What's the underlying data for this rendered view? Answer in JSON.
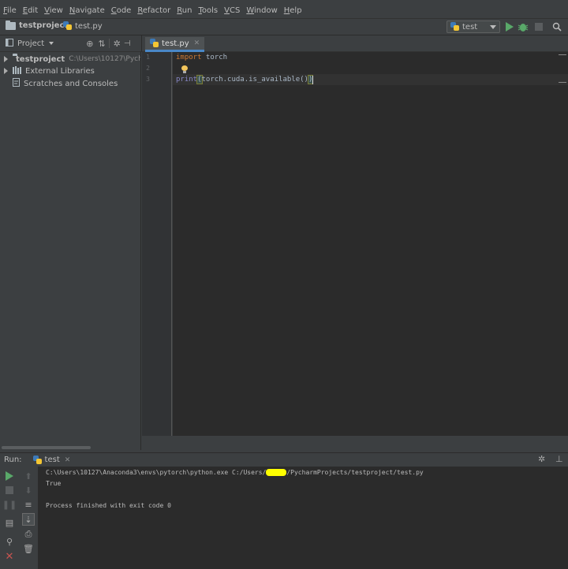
{
  "menu": [
    {
      "u": "F",
      "rest": "ile"
    },
    {
      "u": "E",
      "rest": "dit"
    },
    {
      "u": "V",
      "rest": "iew"
    },
    {
      "u": "N",
      "rest": "avigate"
    },
    {
      "u": "C",
      "rest": "ode"
    },
    {
      "u": "R",
      "rest": "efactor"
    },
    {
      "u": "R",
      "rest": "un"
    },
    {
      "u": "T",
      "rest": "ools"
    },
    {
      "u": "V",
      "rest": "CS"
    },
    {
      "u": "W",
      "rest": "indow"
    },
    {
      "u": "H",
      "rest": "elp"
    }
  ],
  "navbar": {
    "project": "testproject",
    "file": "test.py",
    "run_config": "test"
  },
  "project_panel": {
    "title": "Project",
    "tree": [
      {
        "label": "testproject",
        "path": "C:\\Users\\10127\\Pycha"
      },
      {
        "label": "External Libraries"
      },
      {
        "label": "Scratches and Consoles"
      }
    ]
  },
  "editor": {
    "tab": "test.py",
    "line_numbers": [
      "1",
      "2",
      "3"
    ],
    "line1": {
      "keyword": "import",
      "rest": " torch"
    },
    "line3": {
      "builtin": "print",
      "open": "(",
      "body": "torch.cuda.is_available()",
      "close": ")"
    }
  },
  "run": {
    "label": "Run:",
    "tab": "test",
    "output": {
      "cmd_before": "C:\\Users\\10127\\Anaconda3\\envs\\pytorch\\python.exe C:/Users/",
      "cmd_after": "/PycharmProjects/testproject/test.py",
      "result": "True",
      "finished": "Process finished with exit code 0"
    }
  },
  "colors": {
    "accent": "#4a88c7",
    "run_green": "#59a869",
    "stop_red": "#c75450"
  }
}
